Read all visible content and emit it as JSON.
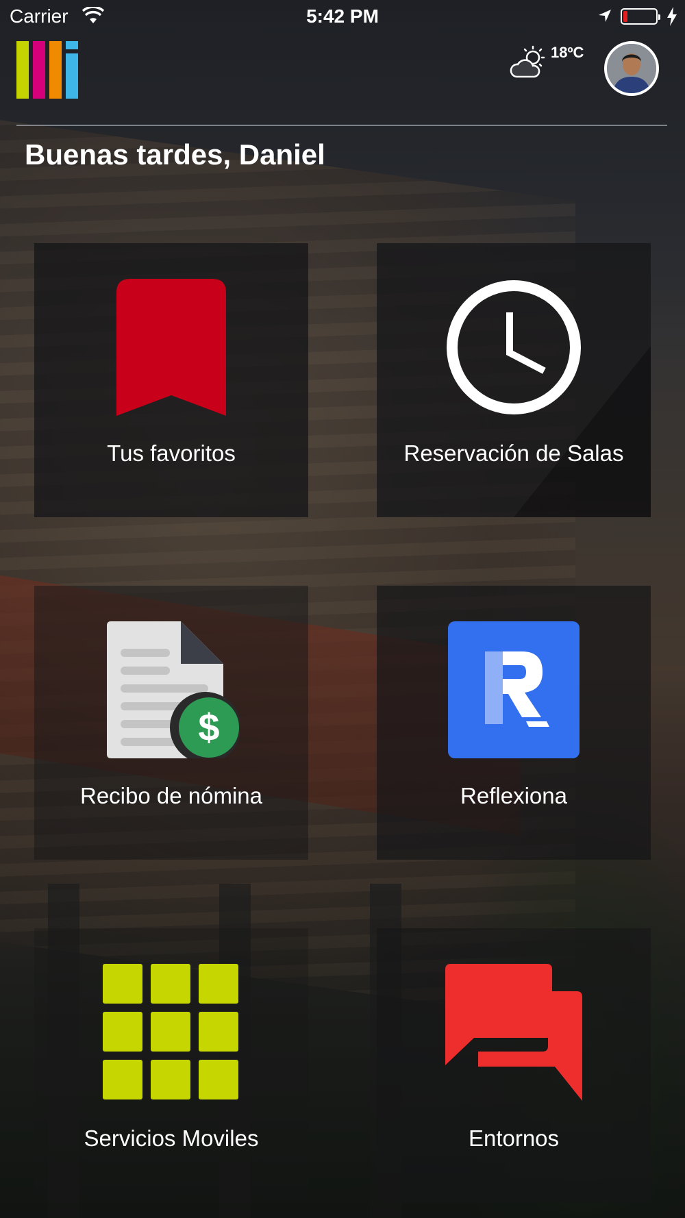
{
  "status_bar": {
    "carrier": "Carrier",
    "time": "5:42 PM",
    "icons": [
      "wifi-icon",
      "location-arrow-icon",
      "battery-icon",
      "charging-bolt-icon"
    ],
    "battery_level": 0.1,
    "battery_color": "#e02020"
  },
  "header": {
    "logo_colors": [
      "#c5d300",
      "#d6007a",
      "#f08a00",
      "#3fb6e8"
    ],
    "weather": {
      "icon": "partly-cloudy-icon",
      "temperature": "18ºC"
    },
    "avatar": "user-avatar"
  },
  "greeting": "Buenas tardes, Daniel",
  "tiles": [
    {
      "label": "Tus favoritos",
      "icon": "bookmark-icon",
      "color": "#c8001a"
    },
    {
      "label": "Reservación de Salas",
      "icon": "clock-icon",
      "color": "#ffffff"
    },
    {
      "label": "Recibo de nómina",
      "icon": "payroll-receipt-icon",
      "color": "#2e9b55"
    },
    {
      "label": "Reflexiona",
      "icon": "reflexiona-r-icon",
      "color": "#3370f0"
    },
    {
      "label": "Servicios Moviles",
      "icon": "grid-apps-icon",
      "color": "#c5d600"
    },
    {
      "label": "Entornos",
      "icon": "chat-bubbles-icon",
      "color": "#ee2d2d"
    }
  ]
}
